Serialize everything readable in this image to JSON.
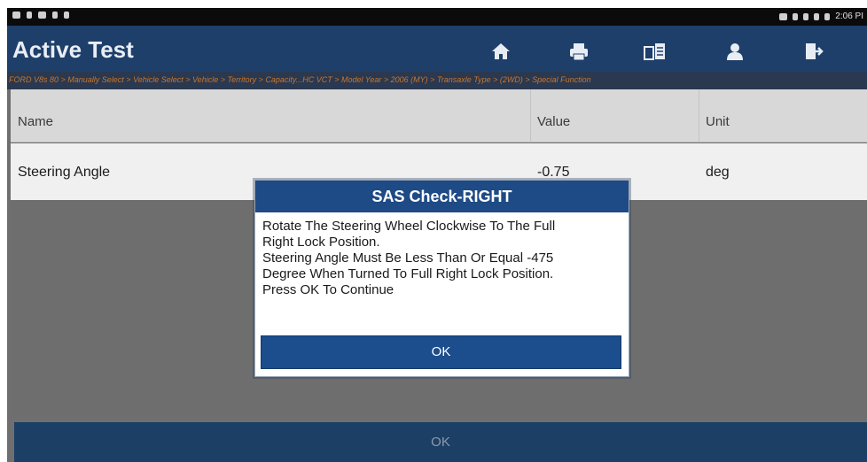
{
  "status_bar": {
    "time": "2:06 PI",
    "left_icons": [
      "notification-icon",
      "wifi-icon",
      "media-icon",
      "battery-small-icon",
      "download-icon"
    ],
    "right_icons": [
      "screen-icon",
      "location-icon",
      "bluetooth-icon",
      "signal-icon",
      "battery-icon"
    ]
  },
  "header": {
    "title": "Active Test",
    "icons": [
      "home-icon",
      "print-icon",
      "report-icon",
      "user-icon",
      "exit-icon"
    ]
  },
  "breadcrumb": "FORD V8s 80 > Manually Select > Vehicle Select > Vehicle > Territory > Capacity...HC VCT > Model Year > 2006 (MY) > Transaxle Type > (2WD) > Special Function",
  "table": {
    "columns": [
      "Name",
      "Value",
      "Unit"
    ],
    "rows": [
      {
        "name": "Steering Angle",
        "value": "-0.75",
        "unit": "deg"
      }
    ]
  },
  "bottom_button": "OK",
  "dialog": {
    "title": "SAS Check-RIGHT",
    "lines": [
      "Rotate The Steering Wheel Clockwise To The Full",
      "Right Lock Position.",
      "Steering Angle Must Be Less Than Or Equal -475",
      "Degree When Turned To Full Right Lock Position.",
      "Press OK To Continue"
    ],
    "ok_label": "OK"
  },
  "colors": {
    "header_bg": "#1e3f6a",
    "dialog_title_bg": "#1e4a85",
    "breadcrumb_text": "#c9762c",
    "overlay_gray": "#6f6f6f"
  }
}
